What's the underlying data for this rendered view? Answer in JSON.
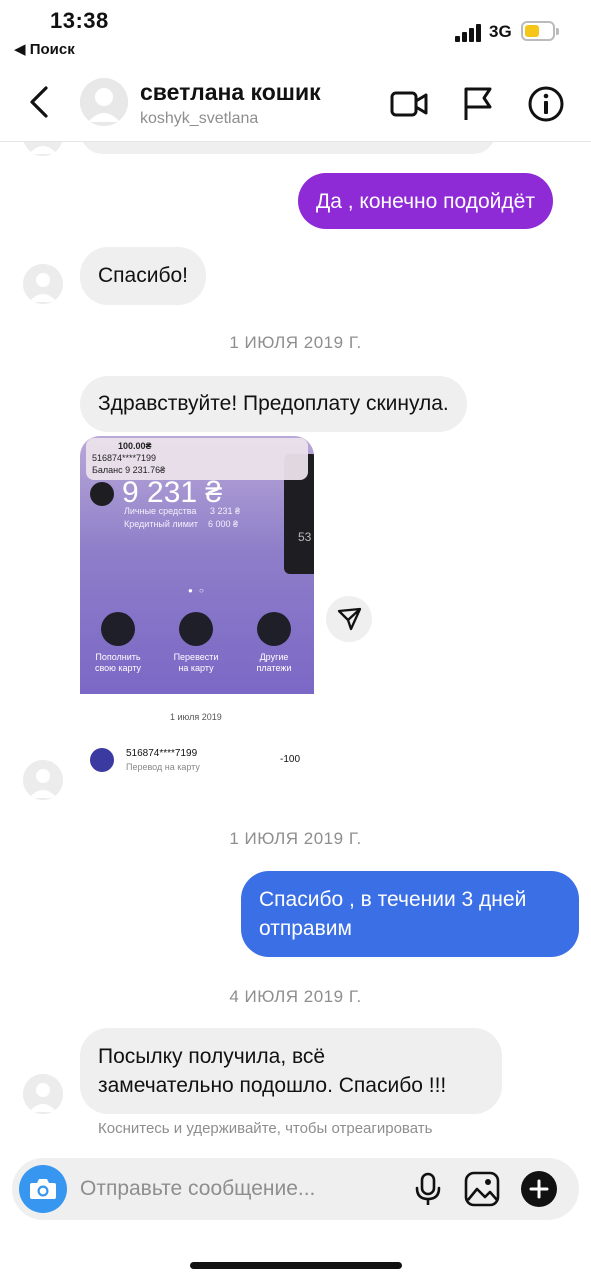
{
  "status_bar": {
    "time": "13:38",
    "back_app": "◀ Поиск",
    "network": "3G"
  },
  "header": {
    "name": "светлана кошик",
    "username": "koshyk_svetlana"
  },
  "messages": {
    "out_1": "Да , конечно подойдёт",
    "in_1": "Спасибо!",
    "date_1": "1 ИЮЛЯ 2019 Г.",
    "in_2": "Здравствуйте! Предоплату скинула.",
    "date_2": "1 ИЮЛЯ 2019 Г.",
    "out_2_line1": "Спасибо , в течении 3 дней",
    "out_2_line2": "отправим",
    "date_3": "4 ИЮЛЯ 2019 Г.",
    "in_3_line1": "Посылку получила, всё",
    "in_3_line2": "замечательно подошло. Спасибо !!!",
    "react_hint": "Коснитесь и удерживайте, чтобы отреагировать"
  },
  "attachment": {
    "notif_amount": "100.00₴",
    "notif_card": "516874****7199",
    "notif_balance": "Баланс 9 231.76₴",
    "balance": "9 231 ₴",
    "own_funds_label": "Личные средства",
    "own_funds_value": "3 231 ₴",
    "credit_label": "Кредитный лимит",
    "credit_value": "6 000 ₴",
    "card_peek": "53",
    "action_1": "Пополнить своюкарту",
    "action_1_l1": "Пополнить",
    "action_1_l2": "свою карту",
    "action_2_l1": "Перевести",
    "action_2_l2": "на карту",
    "action_3_l1": "Другие",
    "action_3_l2": "платежи",
    "tx_date": "1 июля 2019",
    "tx_card": "516874****7199",
    "tx_desc": "Перевод на карту",
    "tx_amount": "-100"
  },
  "composer": {
    "placeholder": "Отправьте сообщение..."
  },
  "colors": {
    "purple_bubble": "#8e2ad6",
    "blue_bubble": "#3b6fe6",
    "camera": "#3797f0"
  }
}
